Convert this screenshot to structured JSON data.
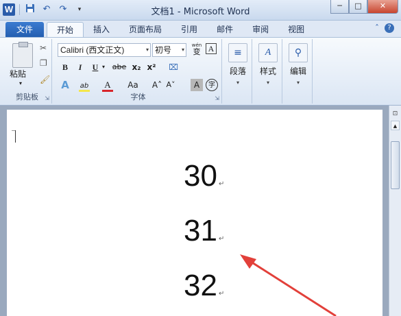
{
  "window": {
    "app_icon_letter": "W",
    "title": "文档1 - Microsoft Word",
    "controls": {
      "minimize": "─",
      "maximize": "□",
      "close": "✕"
    }
  },
  "qat": {
    "save": "save-icon",
    "undo": "↶",
    "redo": "↷",
    "customize": "▾"
  },
  "tabs": {
    "file": "文件",
    "items": [
      "开始",
      "插入",
      "页面布局",
      "引用",
      "邮件",
      "审阅",
      "视图"
    ],
    "active_index": 0,
    "right": {
      "minimize_ribbon": "ˆ",
      "help": "?"
    }
  },
  "ribbon": {
    "clipboard": {
      "paste_label": "粘贴",
      "group_label": "剪贴板"
    },
    "font": {
      "name": "Calibri (西文正文)",
      "size": "初号",
      "group_label": "字体",
      "buttons_row2": [
        "B",
        "I",
        "U",
        "abe",
        "x₂",
        "x²"
      ],
      "buttons_row3": [
        "A",
        "ab",
        "A",
        "Aa",
        "A˄",
        "A˅",
        "A",
        "字"
      ],
      "wen_label": "wén",
      "wen_char": "变",
      "border_char": "A"
    },
    "paragraph": {
      "label": "段落"
    },
    "styles": {
      "label": "样式"
    },
    "editing": {
      "label": "编辑"
    }
  },
  "document": {
    "lines": [
      "30",
      "31",
      "32"
    ],
    "para_mark": "↵"
  },
  "colors": {
    "file_tab": "#245fb1",
    "arrow": "#e2403a",
    "highlight": "#f4e64a",
    "font_color": "#d8252b"
  }
}
